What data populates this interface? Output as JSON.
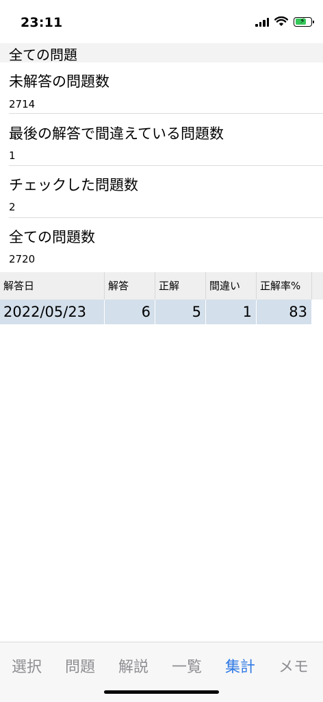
{
  "status_bar": {
    "time": "23:11",
    "icons": [
      "signal-icon",
      "wifi-icon",
      "battery-charging-icon"
    ],
    "battery_level": 0.7
  },
  "section": {
    "title": "全ての問題"
  },
  "stats": [
    {
      "label": "未解答の問題数",
      "value": "2714"
    },
    {
      "label": "最後の解答で間違えている問題数",
      "value": "1"
    },
    {
      "label": "チェックした問題数",
      "value": "2"
    },
    {
      "label": "全ての問題数",
      "value": "2720"
    }
  ],
  "table": {
    "headers": [
      "解答日",
      "解答",
      "正解",
      "間違い",
      "正解率%"
    ],
    "rows": [
      [
        "2022/05/23",
        "6",
        "5",
        "1",
        "83"
      ]
    ]
  },
  "tabbar": {
    "tabs": [
      {
        "label": "選択"
      },
      {
        "label": "問題"
      },
      {
        "label": "解説"
      },
      {
        "label": "一覧"
      },
      {
        "label": "集計"
      },
      {
        "label": "メモ"
      }
    ],
    "active_index": 4,
    "active_color": "#2f7ae5",
    "inactive_color": "#8e8e93"
  },
  "colors": {
    "table_row_bg": "#d3dfeb",
    "battery_fill": "#34c759"
  }
}
